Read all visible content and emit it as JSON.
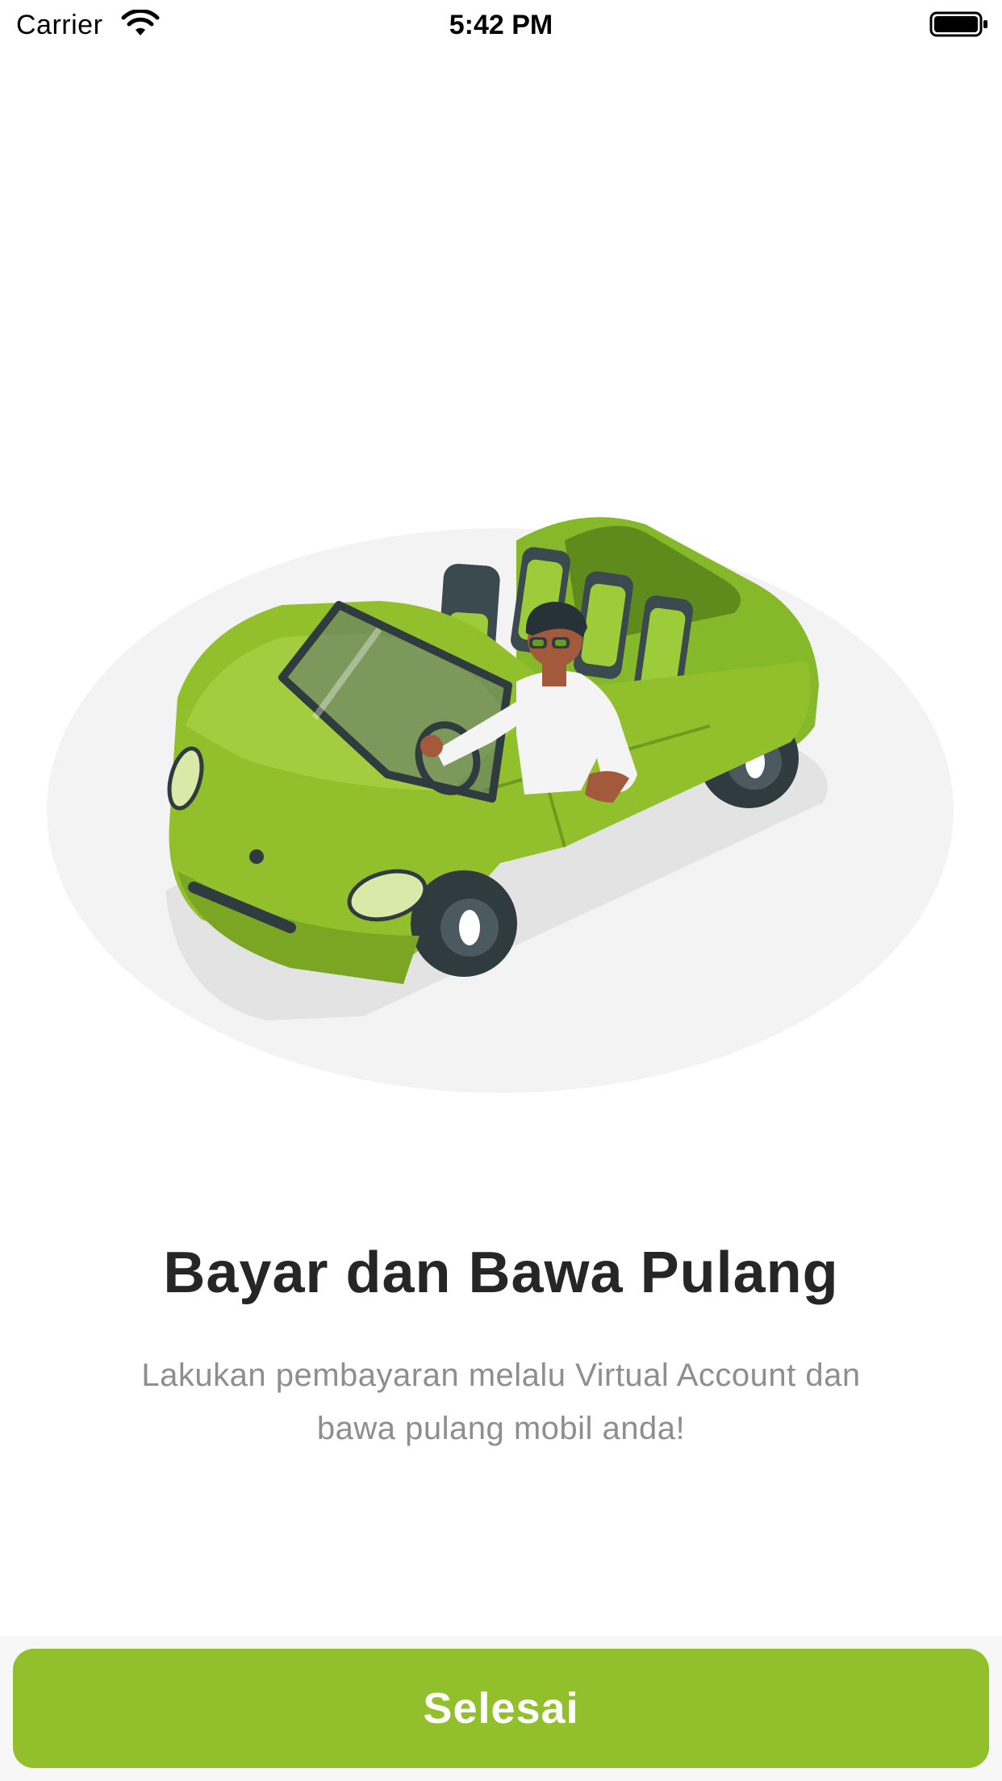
{
  "status_bar": {
    "carrier": "Carrier",
    "time": "5:42 PM",
    "wifi_icon": "wifi-icon",
    "battery_icon": "battery-full-icon"
  },
  "onboarding": {
    "illustration": "man-driving-green-convertible-car",
    "title": "Bayar dan Bawa Pulang",
    "description": "Lakukan pembayaran melalu Virtual Account dan bawa pulang mobil anda!"
  },
  "footer": {
    "button_label": "Selesai"
  },
  "colors": {
    "accent": "#92c02c",
    "title_text": "#262626",
    "body_text": "#8e8e8e",
    "illustration_backdrop": "#f3f3f3"
  }
}
